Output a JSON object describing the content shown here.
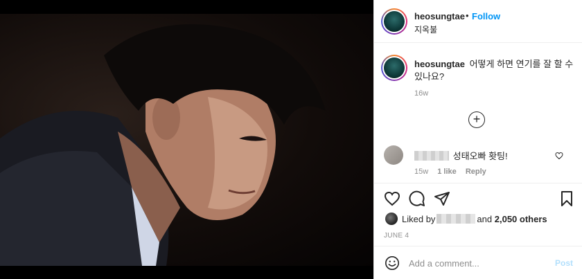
{
  "header": {
    "username": "heosungtae",
    "separator": "•",
    "follow_label": "Follow",
    "location": "지옥불"
  },
  "caption": {
    "username": "heosungtae",
    "text": "어떻게 하면 연기를 잘 할 수 있나요?",
    "time": "16w"
  },
  "load_more_symbol": "+",
  "comments": [
    {
      "text": "성태오빠 홧팅!",
      "time": "15w",
      "likes": "1 like",
      "reply_label": "Reply"
    }
  ],
  "likes": {
    "prefix": "Liked by",
    "suffix_join": "and",
    "count": "2,050 others"
  },
  "date": "JUNE 4",
  "composer": {
    "placeholder": "Add a comment...",
    "post_label": "Post"
  },
  "icons": [
    "heart-icon",
    "comment-icon",
    "share-icon",
    "bookmark-icon",
    "emoji-icon",
    "plus-circle-icon"
  ],
  "colors": {
    "accent": "#0095f6",
    "muted": "#8e8e8e",
    "post_disabled": "#b2dffc"
  }
}
